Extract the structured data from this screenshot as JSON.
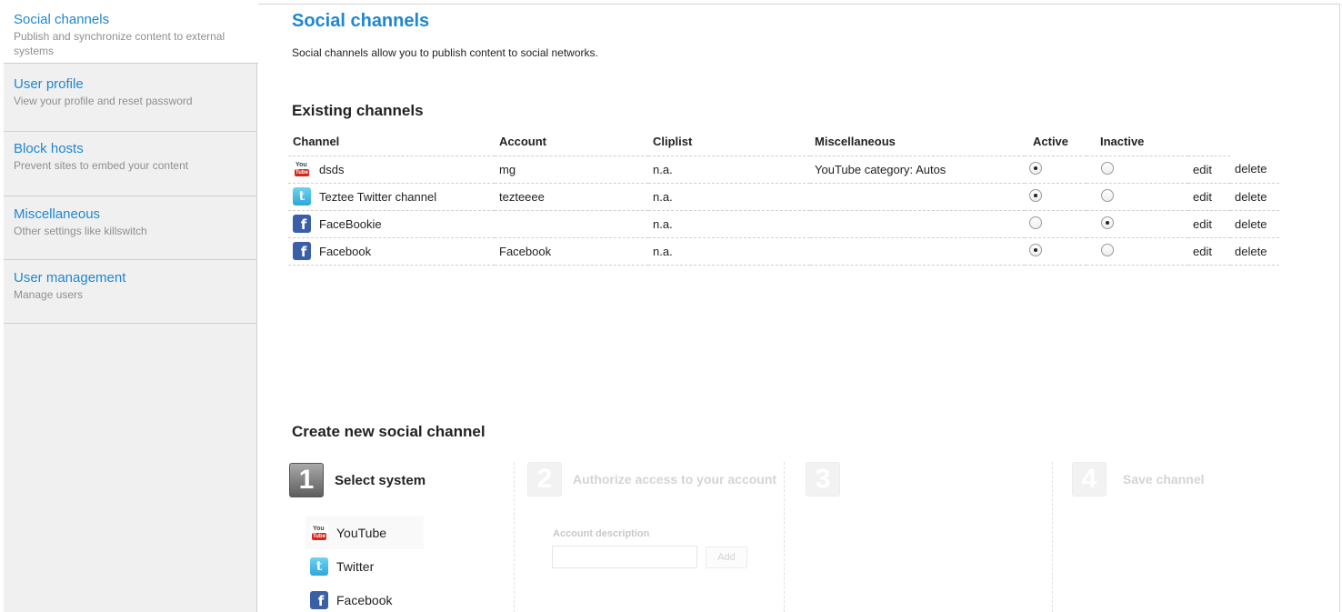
{
  "sidebar": {
    "items": [
      {
        "title": "Social channels",
        "desc": "Publish and synchronize content to external systems"
      },
      {
        "title": "User profile",
        "desc": "View your profile and reset password"
      },
      {
        "title": "Block hosts",
        "desc": "Prevent sites to embed your content"
      },
      {
        "title": "Miscellaneous",
        "desc": "Other settings like killswitch"
      },
      {
        "title": "User management",
        "desc": "Manage users"
      }
    ]
  },
  "main": {
    "title": "Social channels",
    "intro": "Social channels allow you to publish content to social networks.",
    "existing_title": "Existing channels",
    "columns": [
      "Channel",
      "Account",
      "Cliplist",
      "Miscellaneous",
      "Active",
      "Inactive"
    ],
    "rows": [
      {
        "icon": "youtube-icon",
        "channel": "dsds",
        "account": "mg",
        "cliplist": "n.a.",
        "misc": "YouTube category: Autos",
        "active": true,
        "edit": "edit",
        "delete": "delete"
      },
      {
        "icon": "twitter-icon",
        "channel": "Teztee Twitter channel",
        "account": "tezteeee",
        "cliplist": "n.a.",
        "misc": "",
        "active": true,
        "edit": "edit",
        "delete": "delete"
      },
      {
        "icon": "facebook-icon",
        "channel": "FaceBookie",
        "account": "",
        "cliplist": "n.a.",
        "misc": "",
        "active": false,
        "edit": "edit",
        "delete": "delete"
      },
      {
        "icon": "facebook-icon",
        "channel": "Facebook",
        "account": "Facebook",
        "cliplist": "n.a.",
        "misc": "",
        "active": true,
        "edit": "edit",
        "delete": "delete"
      }
    ],
    "create_title": "Create new social channel",
    "steps": [
      {
        "num": "1",
        "label": "Select system",
        "active": true
      },
      {
        "num": "2",
        "label": "Authorize access to your account",
        "active": false
      },
      {
        "num": "3",
        "label": "",
        "active": false
      },
      {
        "num": "4",
        "label": "Save channel",
        "active": false
      }
    ],
    "systems": [
      {
        "icon": "youtube-icon",
        "label": "YouTube"
      },
      {
        "icon": "twitter-icon",
        "label": "Twitter"
      },
      {
        "icon": "facebook-icon",
        "label": "Facebook"
      }
    ],
    "account_description_label": "Account description",
    "account_description_value": "",
    "add_label": "Add"
  }
}
